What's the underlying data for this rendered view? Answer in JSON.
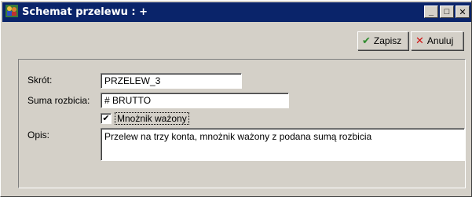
{
  "window": {
    "title": "Schemat przelewu : +",
    "minimize_glyph": "_",
    "maximize_glyph": "□",
    "close_glyph": "✕"
  },
  "toolbar": {
    "save_label": "Zapisz",
    "cancel_label": "Anuluj"
  },
  "form": {
    "shortcut_label": "Skrót:",
    "shortcut_value": "PRZELEW_3",
    "sum_label": "Suma rozbicia:",
    "sum_value": "# BRUTTO",
    "weighted_label": "Mnożnik ważony",
    "weighted_checked": true,
    "description_label": "Opis:",
    "description_value": "Przelew na trzy konta, mnożnik ważony z podana sumą rozbicia"
  },
  "colors": {
    "titlebar": "#0a246a",
    "face": "#d4d0c8",
    "save_icon": "#2e8b2e",
    "cancel_icon": "#d01010"
  },
  "icons": {
    "app": "people-transfer-icon",
    "save": "check-icon",
    "cancel": "x-icon"
  }
}
